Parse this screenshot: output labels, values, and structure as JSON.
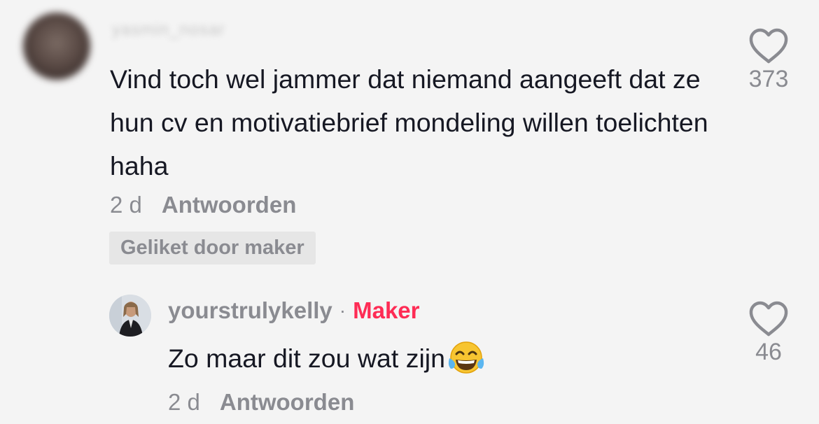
{
  "comment": {
    "username": "yasmin_nosar",
    "text": "Vind toch wel jammer dat niemand aangeeft dat ze hun cv en motivatiebrief mondeling willen toelichten haha",
    "time": "2 d",
    "reply_label": "Antwoorden",
    "badge": "Geliket door maker",
    "likes": "373"
  },
  "reply": {
    "username": "yourstrulykelly",
    "separator": "·",
    "creator_tag": "Maker",
    "text": "Zo maar dit zou wat zijn",
    "emoji": "face-with-tears-of-joy",
    "time": "2 d",
    "reply_label": "Antwoorden",
    "likes": "46"
  },
  "colors": {
    "background": "#f4f4f4",
    "text_primary": "#161823",
    "text_secondary": "#8a8b91",
    "maker_accent": "#fe2c55",
    "badge_bg": "#e6e6e6"
  }
}
